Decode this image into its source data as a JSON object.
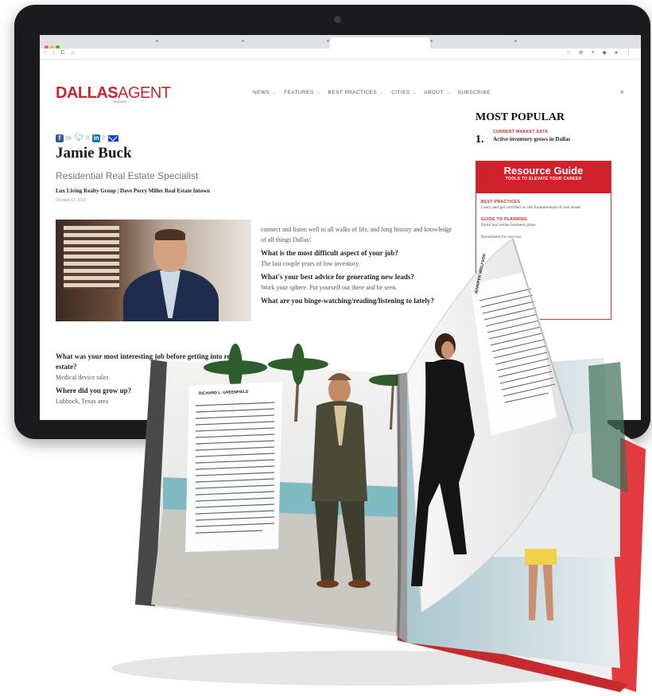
{
  "browser": {
    "nav": "‹ › C ⌂",
    "extensions": "☆ ⊕ ≡ ◆ ● ⋮"
  },
  "site": {
    "logo_main": "DALLAS",
    "logo_accent": "AGENT",
    "logo_sub": "MAGAZINE",
    "menu": [
      "NEWS",
      "FEATURES",
      "BEST PRACTICES",
      "CITIES",
      "ABOUT",
      "SUBSCRIBE"
    ],
    "search_icon": "⌕"
  },
  "article": {
    "share_counts": [
      "16",
      "0",
      "2"
    ],
    "name": "Jamie Buck",
    "role": "Residential Real Estate Specialist",
    "company": "Lux Living Realty Group | Dave Perry Miller Real Estate Intown",
    "date": "October 13, 2022",
    "right_col": [
      {
        "q": "",
        "a": "connect and listen well to all walks of life, and long history and knowledge of all things Dallas!"
      },
      {
        "q": "What is the most difficult aspect of your job?",
        "a": "The last couple years of low inventory."
      },
      {
        "q": "What's your best advice for generating new leads?",
        "a": "Work your sphere. Put yourself out there and be seen."
      },
      {
        "q": "What are you binge-watching/reading/listening to lately?",
        "a": ""
      }
    ],
    "left_col": [
      {
        "q": "What was your most interesting job before getting into real estate?",
        "a": "Medical device sales"
      },
      {
        "q": "Where did you grow up?",
        "a": "Lubbock, Texas area"
      }
    ]
  },
  "sidebar": {
    "most_popular": "MOST POPULAR",
    "rank": "1.",
    "category": "CURRENT MARKET DATA",
    "headline": "Active inventory grows in Dallas",
    "resource_title": "Resource Guide",
    "resource_sub": "TOOLS TO ELEVATE YOUR CAREER",
    "items": [
      {
        "cat": "BEST PRACTICES",
        "text": "Learn and get certified on the fundamentals of real estate"
      },
      {
        "cat": "GUIDE TO PLANNING",
        "text": "Build real estate business plans"
      },
      {
        "cat": "",
        "text": "Investment for success"
      }
    ]
  },
  "magazine": {
    "left_page_name": "RICHARD L. GREENFIELD",
    "right_page_name": "JENNIFER WOLFSON"
  },
  "colors": {
    "brand_red": "#c8262e",
    "facebook": "#3b5998",
    "linkedin": "#0e76a8",
    "twitter": "#1da1f2",
    "mail": "#1a44c8"
  }
}
